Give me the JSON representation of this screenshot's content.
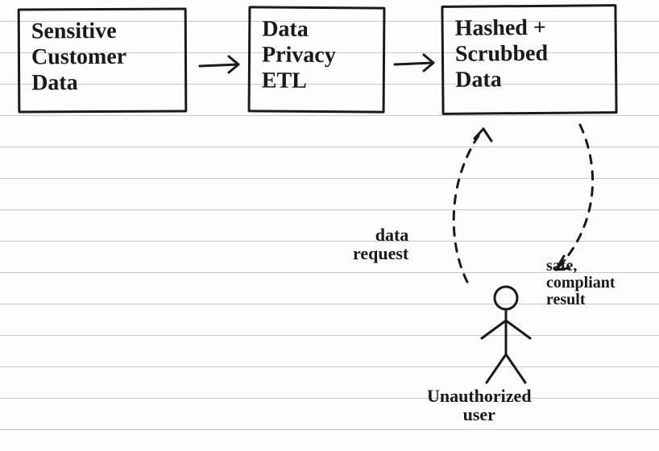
{
  "boxes": {
    "source": {
      "line1": "Sensitive",
      "line2": "Customer",
      "line3": "Data"
    },
    "etl": {
      "line1": "Data",
      "line2": "Privacy",
      "line3": "ETL"
    },
    "output": {
      "line1": "Hashed +",
      "line2": "Scrubbed",
      "line3": "Data"
    }
  },
  "labels": {
    "request": "data\nrequest",
    "result": "safe,\ncompliant\nresult",
    "user": "Unauthorized\nuser"
  }
}
